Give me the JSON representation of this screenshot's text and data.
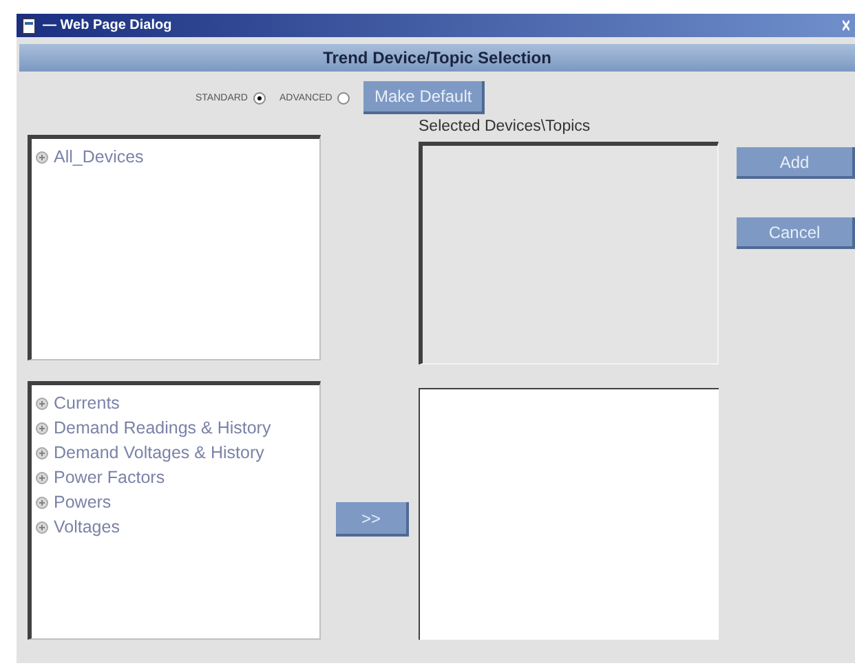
{
  "window": {
    "title": "— Web Page Dialog"
  },
  "header": {
    "title": "Trend Device/Topic Selection"
  },
  "mode_options": [
    {
      "label": "STANDARD",
      "selected": true
    },
    {
      "label": "ADVANCED",
      "selected": false
    }
  ],
  "make_default_button": "Make Default",
  "device_tree": [
    {
      "label": "All_Devices"
    }
  ],
  "topic_tree": [
    {
      "label": "Currents"
    },
    {
      "label": "Demand Readings & History"
    },
    {
      "label": "Demand Voltages & History"
    },
    {
      "label": "Power Factors"
    },
    {
      "label": "Powers"
    },
    {
      "label": "Voltages"
    }
  ],
  "selected_label": "Selected Devices\\Topics",
  "add_topic_button": ">>",
  "buttons": [
    "Add",
    "Cancel"
  ]
}
